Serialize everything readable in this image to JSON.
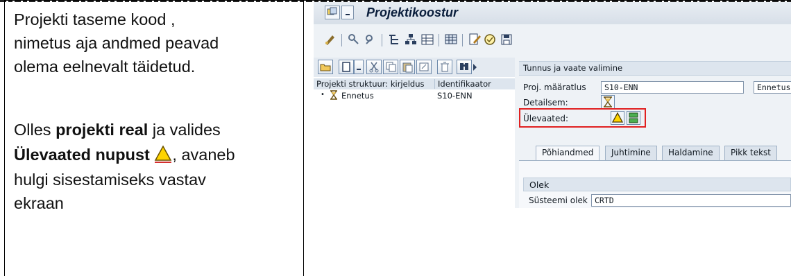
{
  "instructions": {
    "line1": "Projekti taseme kood ,",
    "line2": "nimetus aja andmed peavad",
    "line3": "olema eelnevalt täidetud.",
    "line4": "Olles ",
    "line4_bold": "projekti real",
    "line4_rest": " ja valides",
    "line5_bold": "Ülevaated nupust ",
    "line5_rest": ", avaneb",
    "line6": "hulgi sisestamiseks vastav",
    "line7": "ekraan"
  },
  "window": {
    "title": "Projektikoostur"
  },
  "tree": {
    "col1": "Projekti struktuur: kirjeldus",
    "col2": "Identifikaator",
    "row_desc": "Ennetus",
    "row_id": "S10-ENN"
  },
  "detail": {
    "group_title": "Tunnus ja vaate valimine",
    "proj_label": "Proj. määratlus",
    "proj_value": "S10-ENN",
    "proj_desc": "Ennetus",
    "detailsem_label": "Detailsem:",
    "ulevaated_label": "Ülevaated:"
  },
  "tabs": [
    "Põhiandmed",
    "Juhtimine",
    "Haldamine",
    "Pikk tekst"
  ],
  "status": {
    "group": "Olek",
    "label": "Süsteemi olek",
    "value": "CRTD"
  },
  "colors": {
    "highlight": "#e02020",
    "warning_yellow": "#ffd400"
  }
}
